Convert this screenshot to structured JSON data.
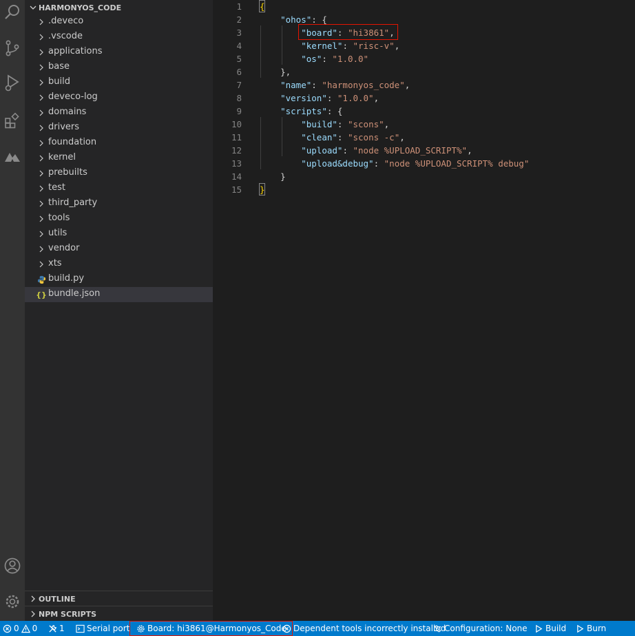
{
  "sidebar": {
    "root_title": "HARMONYOS_CODE",
    "folders": [
      "deveco",
      "vscode",
      "applications",
      "base",
      "build",
      "deveco-log",
      "domains",
      "drivers",
      "foundation",
      "kernel",
      "prebuilts",
      "test",
      "third_party",
      "tools",
      "utils",
      "vendor",
      "xts"
    ],
    "folder_labels": [
      ".deveco",
      ".vscode",
      "applications",
      "base",
      "build",
      "deveco-log",
      "domains",
      "drivers",
      "foundation",
      "kernel",
      "prebuilts",
      "test",
      "third_party",
      "tools",
      "utils",
      "vendor",
      "xts"
    ],
    "files": [
      {
        "label": "build.py",
        "icon": "python-file-icon"
      },
      {
        "label": "bundle.json",
        "icon": "json-file-icon",
        "glyph": "{}"
      }
    ],
    "outline_title": "OUTLINE",
    "npm_title": "NPM SCRIPTS"
  },
  "editor": {
    "line_numbers": [
      "1",
      "2",
      "3",
      "4",
      "5",
      "6",
      "7",
      "8",
      "9",
      "10",
      "11",
      "12",
      "13",
      "14",
      "15"
    ],
    "lines": [
      [
        {
          "t": "{",
          "c": "b"
        }
      ],
      [
        {
          "t": "    ",
          "c": "p"
        },
        {
          "t": "\"ohos\"",
          "c": "k"
        },
        {
          "t": ": {",
          "c": "p"
        }
      ],
      [
        {
          "t": "        ",
          "c": "p"
        },
        {
          "t": "\"board\"",
          "c": "k"
        },
        {
          "t": ": ",
          "c": "p"
        },
        {
          "t": "\"hi3861\"",
          "c": "s"
        },
        {
          "t": ",",
          "c": "p"
        }
      ],
      [
        {
          "t": "        ",
          "c": "p"
        },
        {
          "t": "\"kernel\"",
          "c": "k"
        },
        {
          "t": ": ",
          "c": "p"
        },
        {
          "t": "\"risc-v\"",
          "c": "s"
        },
        {
          "t": ",",
          "c": "p"
        }
      ],
      [
        {
          "t": "        ",
          "c": "p"
        },
        {
          "t": "\"os\"",
          "c": "k"
        },
        {
          "t": ": ",
          "c": "p"
        },
        {
          "t": "\"1.0.0\"",
          "c": "s"
        }
      ],
      [
        {
          "t": "    },",
          "c": "p"
        }
      ],
      [
        {
          "t": "    ",
          "c": "p"
        },
        {
          "t": "\"name\"",
          "c": "k"
        },
        {
          "t": ": ",
          "c": "p"
        },
        {
          "t": "\"harmonyos_code\"",
          "c": "s"
        },
        {
          "t": ",",
          "c": "p"
        }
      ],
      [
        {
          "t": "    ",
          "c": "p"
        },
        {
          "t": "\"version\"",
          "c": "k"
        },
        {
          "t": ": ",
          "c": "p"
        },
        {
          "t": "\"1.0.0\"",
          "c": "s"
        },
        {
          "t": ",",
          "c": "p"
        }
      ],
      [
        {
          "t": "    ",
          "c": "p"
        },
        {
          "t": "\"scripts\"",
          "c": "k"
        },
        {
          "t": ": {",
          "c": "p"
        }
      ],
      [
        {
          "t": "        ",
          "c": "p"
        },
        {
          "t": "\"build\"",
          "c": "k"
        },
        {
          "t": ": ",
          "c": "p"
        },
        {
          "t": "\"scons\"",
          "c": "s"
        },
        {
          "t": ",",
          "c": "p"
        }
      ],
      [
        {
          "t": "        ",
          "c": "p"
        },
        {
          "t": "\"clean\"",
          "c": "k"
        },
        {
          "t": ": ",
          "c": "p"
        },
        {
          "t": "\"scons -c\"",
          "c": "s"
        },
        {
          "t": ",",
          "c": "p"
        }
      ],
      [
        {
          "t": "        ",
          "c": "p"
        },
        {
          "t": "\"upload\"",
          "c": "k"
        },
        {
          "t": ": ",
          "c": "p"
        },
        {
          "t": "\"node %UPLOAD_SCRIPT%\"",
          "c": "s"
        },
        {
          "t": ",",
          "c": "p"
        }
      ],
      [
        {
          "t": "        ",
          "c": "p"
        },
        {
          "t": "\"upload&debug\"",
          "c": "k"
        },
        {
          "t": ": ",
          "c": "p"
        },
        {
          "t": "\"node %UPLOAD_SCRIPT% debug\"",
          "c": "s"
        }
      ],
      [
        {
          "t": "    }",
          "c": "p"
        }
      ],
      [
        {
          "t": "}",
          "c": "b"
        }
      ]
    ]
  },
  "statusbar": {
    "errors": "0",
    "warnings": "0",
    "tools_count": "1",
    "serial_port": "Serial port",
    "board": "Board: hi3861@Harmonyos_Code",
    "dependent_tools": "Dependent tools incorrectly installed",
    "configuration": "Configuration: None",
    "build": "Build",
    "burn": "Burn"
  },
  "colors": {
    "status_bar": "#007acc",
    "highlight_box": "#e51400"
  }
}
